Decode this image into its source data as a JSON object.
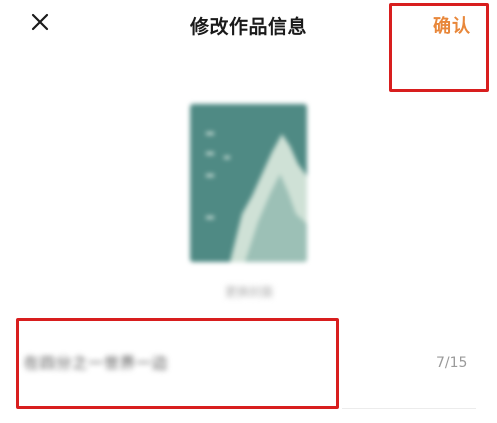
{
  "header": {
    "close_icon": "close-icon",
    "title": "修改作品信息",
    "confirm_label": "确认"
  },
  "cover": {
    "caption": "更换封面"
  },
  "title_field": {
    "value": "在四分之一世界一边",
    "counter": "7/15"
  },
  "colors": {
    "accent": "#e8873a",
    "highlight": "#d81e1e",
    "cover_bg": "#4f8a84",
    "cover_mountain": "#cfe1d6"
  }
}
